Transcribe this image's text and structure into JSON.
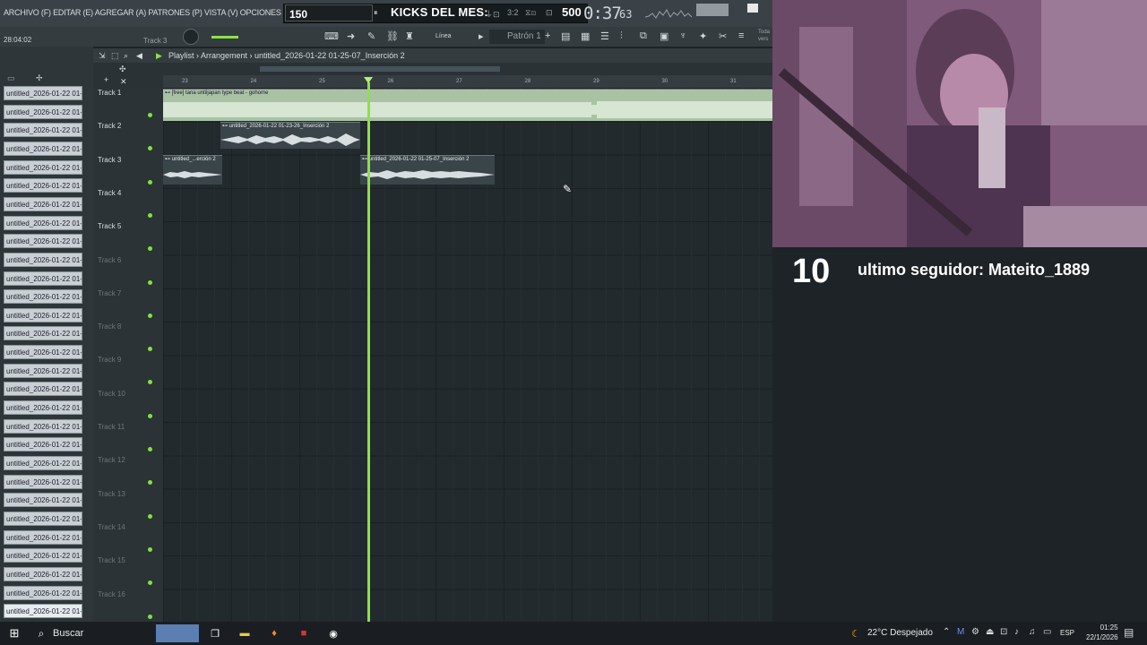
{
  "menu": {
    "text": "ARCHIVO (F) EDITAR (E) AGREGAR (A) PATRONES (P) VISTA (V) OPCIONES (O) HERRAMIENTAS"
  },
  "transport": {
    "tempo": "150",
    "kicks_label": "KICKS DEL MES:",
    "kicks_value": "500",
    "clock_main": "0:37",
    "clock_sub": "63",
    "time_small": "28:04:02",
    "current_track": "Track 3",
    "pattern": "Patrón 1",
    "snap_mode": "Línea",
    "todas": [
      "Toda",
      "vers"
    ]
  },
  "playlist": {
    "breadcrumb": "Playlist › Arrangement › untitled_2026-01-22 01-25-07_Inserción 2",
    "ruler_numbers": [
      "23",
      "24",
      "25",
      "26",
      "27",
      "28",
      "29",
      "30",
      "31"
    ],
    "tracks": [
      {
        "name": "Track 1",
        "active": true
      },
      {
        "name": "Track 2",
        "active": true
      },
      {
        "name": "Track 3",
        "active": true
      },
      {
        "name": "Track 4",
        "active": true
      },
      {
        "name": "Track 5",
        "active": true
      },
      {
        "name": "Track 6",
        "active": false
      },
      {
        "name": "Track 7",
        "active": false
      },
      {
        "name": "Track 8",
        "active": false
      },
      {
        "name": "Track 9",
        "active": false
      },
      {
        "name": "Track 10",
        "active": false
      },
      {
        "name": "Track 11",
        "active": false
      },
      {
        "name": "Track 12",
        "active": false
      },
      {
        "name": "Track 13",
        "active": false
      },
      {
        "name": "Track 14",
        "active": false
      },
      {
        "name": "Track 15",
        "active": false
      },
      {
        "name": "Track 16",
        "active": false
      }
    ],
    "clips": [
      {
        "label": "⊷ [free] tana  untiljapan type beat - gohome"
      },
      {
        "label": "⊷ untitled_2026-01-22 01-23-26_Inserción 2"
      },
      {
        "label": "⊷ untitled_...erción 2"
      },
      {
        "label": "⊷ untitled_2026-01-22 01-25-07_Inserción 2"
      }
    ]
  },
  "channels": {
    "item_label": "untitled_2026-01-22 01-..."
  },
  "overlay": {
    "follower_count": "10",
    "follower_text": "ultimo seguidor: Mateito_1889"
  },
  "taskbar": {
    "search": "Buscar",
    "weather": "22°C  Despejado",
    "language": "ESP",
    "time": "01:25",
    "date": "22/1/2026"
  },
  "colors": {
    "playhead": "#8ee04a",
    "grid_bg": "#222a2d",
    "clip_bg": "#3a4549",
    "accent_led": "#7fe23f"
  }
}
